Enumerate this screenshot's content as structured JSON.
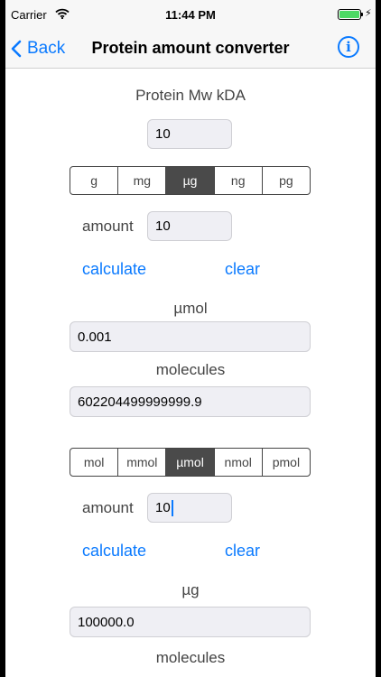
{
  "status": {
    "carrier": "Carrier",
    "time": "11:44 PM",
    "charge_icon": "bolt-icon"
  },
  "nav": {
    "back_label": "Back",
    "title": "Protein amount converter",
    "info_glyph": "i"
  },
  "protein": {
    "label": "Protein Mw kDA",
    "value": "10"
  },
  "mass_units": {
    "items": [
      "g",
      "mg",
      "µg",
      "ng",
      "pg"
    ],
    "selected": "µg"
  },
  "section1": {
    "amount_label": "amount",
    "amount_value": "10",
    "calculate_label": "calculate",
    "clear_label": "clear",
    "result1_label": "µmol",
    "result1_value": "0.001",
    "result2_label": "molecules",
    "result2_value": "602204499999999.9"
  },
  "molar_units": {
    "items": [
      "mol",
      "mmol",
      "µmol",
      "nmol",
      "pmol"
    ],
    "selected": "µmol"
  },
  "section2": {
    "amount_label": "amount",
    "amount_value": "10",
    "calculate_label": "calculate",
    "clear_label": "clear",
    "result1_label": "µg",
    "result1_value": "100000.0",
    "result2_label": "molecules"
  },
  "colors": {
    "accent": "#0a7aff",
    "segment_active": "#4a4a4a",
    "battery": "#4cd964"
  }
}
